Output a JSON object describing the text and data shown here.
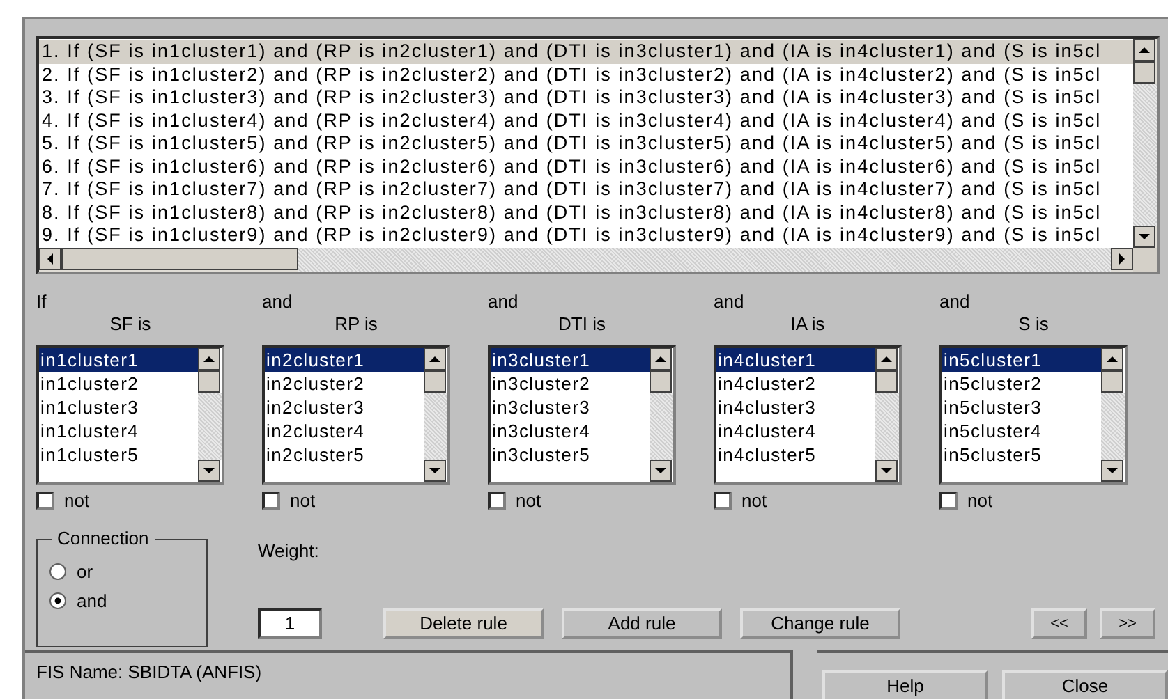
{
  "rules": [
    {
      "text": "1. If (SF is in1cluster1) and (RP is in2cluster1) and (DTI is in3cluster1) and (IA is in4cluster1) and (S is in5cl",
      "selected": true
    },
    {
      "text": "2. If (SF is in1cluster2) and (RP is in2cluster2) and (DTI is in3cluster2) and (IA is in4cluster2) and (S is in5cl",
      "selected": false
    },
    {
      "text": "3. If (SF is in1cluster3) and (RP is in2cluster3) and (DTI is in3cluster3) and (IA is in4cluster3) and (S is in5cl",
      "selected": false
    },
    {
      "text": "4. If (SF is in1cluster4) and (RP is in2cluster4) and (DTI is in3cluster4) and (IA is in4cluster4) and (S is in5cl",
      "selected": false
    },
    {
      "text": "5. If (SF is in1cluster5) and (RP is in2cluster5) and (DTI is in3cluster5) and (IA is in4cluster5) and (S is in5cl",
      "selected": false
    },
    {
      "text": "6. If (SF is in1cluster6) and (RP is in2cluster6) and (DTI is in3cluster6) and (IA is in4cluster6) and (S is in5cl",
      "selected": false
    },
    {
      "text": "7. If (SF is in1cluster7) and (RP is in2cluster7) and (DTI is in3cluster7) and (IA is in4cluster7) and (S is in5cl",
      "selected": false
    },
    {
      "text": "8. If (SF is in1cluster8) and (RP is in2cluster8) and (DTI is in3cluster8) and (IA is in4cluster8) and (S is in5cl",
      "selected": false
    },
    {
      "text": "9. If (SF is in1cluster9) and (RP is in2cluster9) and (DTI is in3cluster9) and (IA is in4cluster9) and (S is in5cl",
      "selected": false
    }
  ],
  "antecedents": [
    {
      "connective": "If",
      "label": "SF is",
      "options": [
        {
          "label": "in1cluster1",
          "selected": true
        },
        {
          "label": "in1cluster2",
          "selected": false
        },
        {
          "label": "in1cluster3",
          "selected": false
        },
        {
          "label": "in1cluster4",
          "selected": false
        },
        {
          "label": "in1cluster5",
          "selected": false
        }
      ],
      "not": {
        "label": "not",
        "checked": false
      }
    },
    {
      "connective": "and",
      "label": "RP is",
      "options": [
        {
          "label": "in2cluster1",
          "selected": true
        },
        {
          "label": "in2cluster2",
          "selected": false
        },
        {
          "label": "in2cluster3",
          "selected": false
        },
        {
          "label": "in2cluster4",
          "selected": false
        },
        {
          "label": "in2cluster5",
          "selected": false
        }
      ],
      "not": {
        "label": "not",
        "checked": false
      }
    },
    {
      "connective": "and",
      "label": "DTI is",
      "options": [
        {
          "label": "in3cluster1",
          "selected": true
        },
        {
          "label": "in3cluster2",
          "selected": false
        },
        {
          "label": "in3cluster3",
          "selected": false
        },
        {
          "label": "in3cluster4",
          "selected": false
        },
        {
          "label": "in3cluster5",
          "selected": false
        }
      ],
      "not": {
        "label": "not",
        "checked": false
      }
    },
    {
      "connective": "and",
      "label": "IA is",
      "options": [
        {
          "label": "in4cluster1",
          "selected": true
        },
        {
          "label": "in4cluster2",
          "selected": false
        },
        {
          "label": "in4cluster3",
          "selected": false
        },
        {
          "label": "in4cluster4",
          "selected": false
        },
        {
          "label": "in4cluster5",
          "selected": false
        }
      ],
      "not": {
        "label": "not",
        "checked": false
      }
    },
    {
      "connective": "and",
      "label": "S is",
      "options": [
        {
          "label": "in5cluster1",
          "selected": true
        },
        {
          "label": "in5cluster2",
          "selected": false
        },
        {
          "label": "in5cluster3",
          "selected": false
        },
        {
          "label": "in5cluster4",
          "selected": false
        },
        {
          "label": "in5cluster5",
          "selected": false
        }
      ],
      "not": {
        "label": "not",
        "checked": false
      }
    }
  ],
  "connection": {
    "title": "Connection",
    "options": [
      {
        "label": "or",
        "selected": false
      },
      {
        "label": "and",
        "selected": true
      }
    ]
  },
  "weight": {
    "label": "Weight:",
    "value": "1"
  },
  "rule_buttons": [
    "Delete rule",
    "Add rule",
    "Change rule"
  ],
  "nav_buttons": [
    "<<",
    ">>"
  ],
  "status": "FIS Name: SBIDTA (ANFIS)",
  "footer_buttons": [
    "Help",
    "Close"
  ]
}
